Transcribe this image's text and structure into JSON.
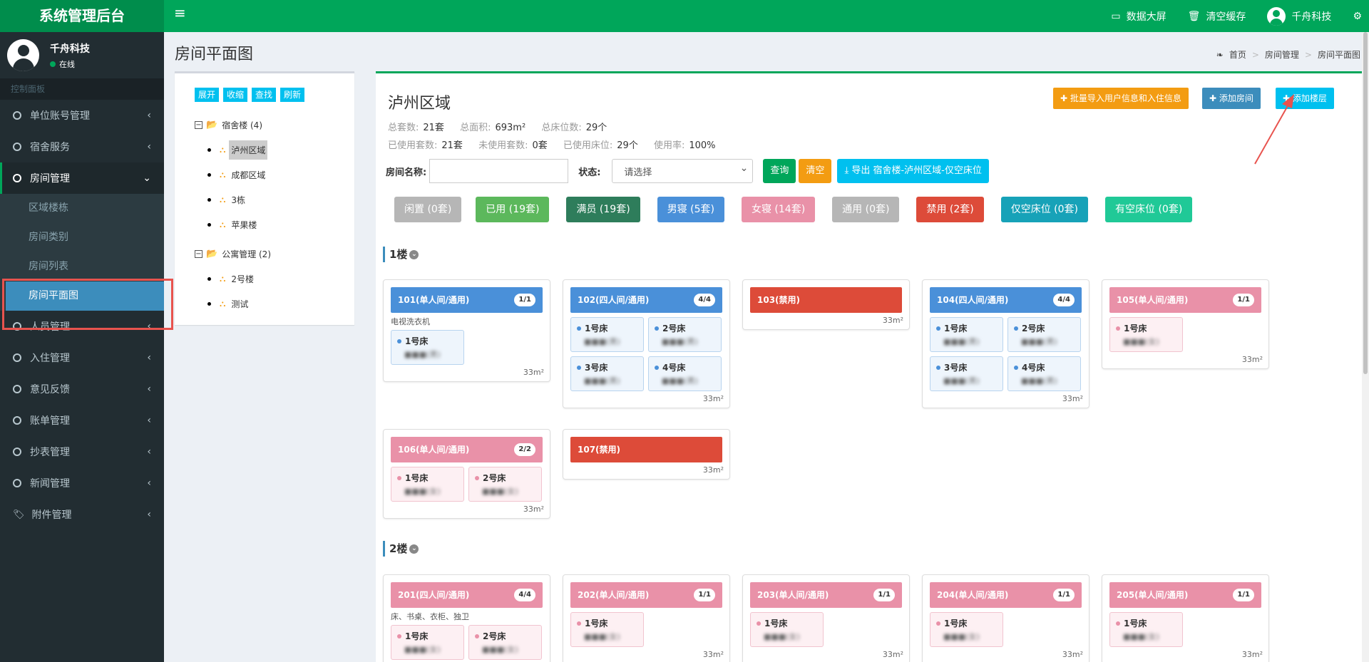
{
  "header": {
    "app_title": "系统管理后台",
    "menu_icon": "hamburger-icon",
    "links": [
      {
        "icon": "monitor-icon",
        "label": "数据大屏"
      },
      {
        "icon": "trash-icon",
        "label": "清空缓存"
      },
      {
        "icon": "user-icon",
        "label": "千舟科技"
      }
    ],
    "settings_icon": "gears-icon"
  },
  "sidebar": {
    "user_name": "千舟科技",
    "user_status": "在线",
    "section_header": "控制面板",
    "items": [
      {
        "label": "单位账号管理"
      },
      {
        "label": "宿舍服务"
      },
      {
        "label": "房间管理"
      },
      {
        "label": "人员管理"
      },
      {
        "label": "入住管理"
      },
      {
        "label": "意见反馈"
      },
      {
        "label": "账单管理"
      },
      {
        "label": "抄表管理"
      },
      {
        "label": "新闻管理"
      },
      {
        "label": "附件管理"
      }
    ],
    "sub_items": [
      {
        "label": "区域楼栋"
      },
      {
        "label": "房间类别"
      },
      {
        "label": "房间列表"
      },
      {
        "label": "房间平面图"
      }
    ]
  },
  "page": {
    "title": "房间平面图",
    "breadcrumb": [
      "首页",
      "房间管理",
      "房间平面图"
    ]
  },
  "tree": {
    "buttons": [
      "展开",
      "收缩",
      "查找",
      "刷新"
    ],
    "groups": [
      {
        "label": "宿舍楼 (4)",
        "children": [
          "泸州区域",
          "成都区域",
          "3栋",
          "苹果楼"
        ]
      },
      {
        "label": "公寓管理 (2)",
        "children": [
          "2号楼",
          "测试"
        ]
      }
    ]
  },
  "main": {
    "area_title": "泸州区域",
    "stats_row1": [
      {
        "label": "总套数:",
        "value": "21套"
      },
      {
        "label": "总面积:",
        "value": "693m²"
      },
      {
        "label": "总床位数:",
        "value": "29个"
      }
    ],
    "stats_row2": [
      {
        "label": "已使用套数:",
        "value": "21套"
      },
      {
        "label": "未使用套数:",
        "value": "0套"
      },
      {
        "label": "已使用床位:",
        "value": "29个"
      },
      {
        "label": "使用率:",
        "value": "100%"
      }
    ],
    "actions": {
      "import": "✚ 批量导入用户信息和入住信息",
      "add_room": "✚ 添加房间",
      "add_floor": "✚ 添加楼层"
    },
    "search": {
      "name_label": "房间名称:",
      "name_value": "",
      "status_label": "状态:",
      "status_value": "请选择",
      "query": "查询",
      "clear": "清空",
      "export": "⤓ 导出 宿舍楼-泸州区域-仅空床位"
    },
    "filters": [
      {
        "label": "闲置 (0套)",
        "color": "#b6b6b6"
      },
      {
        "label": "已用 (19套)",
        "color": "#5cb85c"
      },
      {
        "label": "满员 (19套)",
        "color": "#2e7d5b"
      },
      {
        "label": "男寝 (5套)",
        "color": "#4a90d9"
      },
      {
        "label": "女寝 (14套)",
        "color": "#e991a8"
      },
      {
        "label": "通用 (0套)",
        "color": "#b6b6b6"
      },
      {
        "label": "禁用 (2套)",
        "color": "#dd4b39"
      },
      {
        "label": "仅空床位 (0套)",
        "color": "#17a2b8"
      },
      {
        "label": "有空床位 (0套)",
        "color": "#20c997"
      }
    ]
  },
  "floors": [
    {
      "label": "1楼",
      "rooms": [
        {
          "name": "101(单人间/通用)",
          "badge": "1/1",
          "color": "#4a90d9",
          "desc": "电视洗衣机",
          "beds": [
            {
              "name": "1号床",
              "occ": "■■■(男)",
              "g": "m"
            }
          ],
          "area": "33m²"
        },
        {
          "name": "102(四人间/通用)",
          "badge": "4/4",
          "color": "#4a90d9",
          "desc": "",
          "beds": [
            {
              "name": "1号床",
              "occ": "■■■(男)",
              "g": "m"
            },
            {
              "name": "2号床",
              "occ": "■■■(男)",
              "g": "m"
            },
            {
              "name": "3号床",
              "occ": "■■■(男)",
              "g": "m"
            },
            {
              "name": "4号床",
              "occ": "■■■(男)",
              "g": "m"
            }
          ],
          "area": "33m²"
        },
        {
          "name": "103(禁用)",
          "badge": "",
          "color": "#dd4b39",
          "desc": "",
          "beds": [],
          "area": "33m²"
        },
        {
          "name": "104(四人间/通用)",
          "badge": "4/4",
          "color": "#4a90d9",
          "desc": "",
          "beds": [
            {
              "name": "1号床",
              "occ": "■■■(男)",
              "g": "m"
            },
            {
              "name": "2号床",
              "occ": "■■■(男)",
              "g": "m"
            },
            {
              "name": "3号床",
              "occ": "■■■(男)",
              "g": "m"
            },
            {
              "name": "4号床",
              "occ": "■■■(男)",
              "g": "m"
            }
          ],
          "area": "33m²"
        },
        {
          "name": "105(单人间/通用)",
          "badge": "1/1",
          "color": "#e991a8",
          "desc": "",
          "beds": [
            {
              "name": "1号床",
              "occ": "■■■(女)",
              "g": "f"
            }
          ],
          "area": "33m²"
        },
        {
          "name": "106(单人间/通用)",
          "badge": "2/2",
          "color": "#e991a8",
          "desc": "",
          "beds": [
            {
              "name": "1号床",
              "occ": "■■■(女)",
              "g": "f"
            },
            {
              "name": "2号床",
              "occ": "■■■(女)",
              "g": "f"
            }
          ],
          "area": "33m²"
        },
        {
          "name": "107(禁用)",
          "badge": "",
          "color": "#dd4b39",
          "desc": "",
          "beds": [],
          "area": "33m²"
        }
      ]
    },
    {
      "label": "2楼",
      "rooms": [
        {
          "name": "201(四人间/通用)",
          "badge": "4/4",
          "color": "#e991a8",
          "desc": "床、书桌、衣柜、独卫",
          "beds": [
            {
              "name": "1号床",
              "occ": "■■■(女)",
              "g": "f"
            },
            {
              "name": "2号床",
              "occ": "■■■(女)",
              "g": "f"
            }
          ],
          "area": ""
        },
        {
          "name": "202(单人间/通用)",
          "badge": "1/1",
          "color": "#e991a8",
          "desc": "",
          "beds": [
            {
              "name": "1号床",
              "occ": "■■■(女)",
              "g": "f"
            }
          ],
          "area": "33m²"
        },
        {
          "name": "203(单人间/通用)",
          "badge": "1/1",
          "color": "#e991a8",
          "desc": "",
          "beds": [
            {
              "name": "1号床",
              "occ": "■■■(女)",
              "g": "f"
            }
          ],
          "area": "33m²"
        },
        {
          "name": "204(单人间/通用)",
          "badge": "1/1",
          "color": "#e991a8",
          "desc": "",
          "beds": [
            {
              "name": "1号床",
              "occ": "■■■(女)",
              "g": "f"
            }
          ],
          "area": "33m²"
        },
        {
          "name": "205(单人间/通用)",
          "badge": "1/1",
          "color": "#e991a8",
          "desc": "",
          "beds": [
            {
              "name": "1号床",
              "occ": "■■■(女)",
              "g": "f"
            }
          ],
          "area": "33m²"
        }
      ]
    }
  ]
}
